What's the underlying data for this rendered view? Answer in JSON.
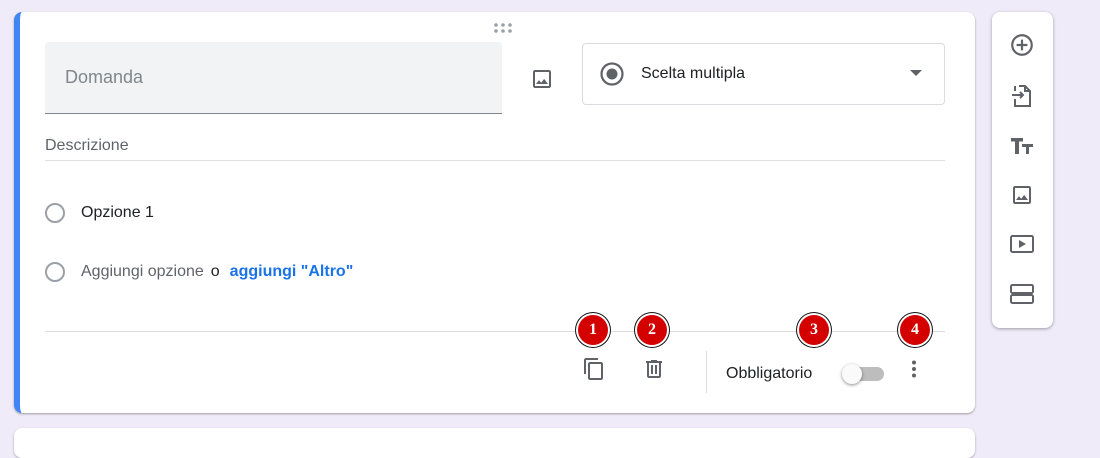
{
  "question": {
    "placeholder": "Domanda",
    "description_label": "Descrizione",
    "type_label": "Scelta multipla"
  },
  "options": {
    "option_1": "Opzione 1",
    "add_option": "Aggiungi opzione",
    "or": "o",
    "add_other": "aggiungi \"Altro\""
  },
  "footer": {
    "required_label": "Obbligatorio",
    "badges": [
      "1",
      "2",
      "3",
      "4"
    ]
  },
  "colors": {
    "accent": "#4285f4",
    "link": "#1a73e8",
    "badge": "#d40000"
  },
  "icons": {
    "question_image": "image-icon",
    "type": "radio-button-icon",
    "duplicate": "copy-icon",
    "delete": "trash-icon",
    "more": "more-vert-icon",
    "toolbar": [
      "add-circle-icon",
      "import-icon",
      "title-icon",
      "image-icon",
      "video-icon",
      "section-icon"
    ]
  }
}
